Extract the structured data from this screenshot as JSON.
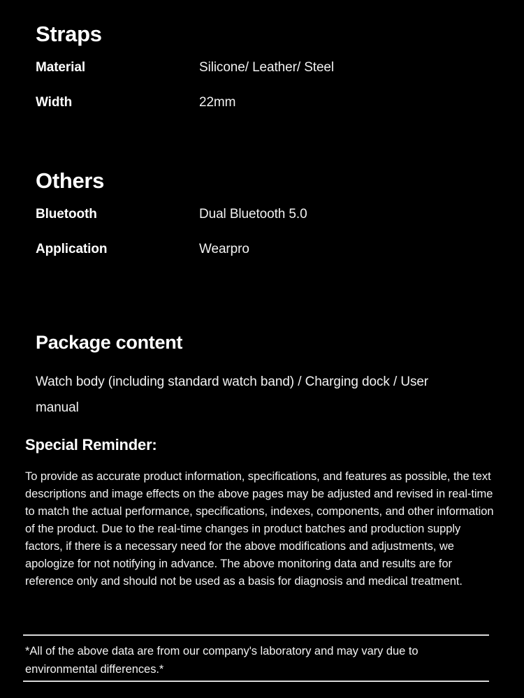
{
  "sections": [
    {
      "heading": "Straps",
      "rows": [
        {
          "label": "Material",
          "value": "Silicone/ Leather/ Steel"
        },
        {
          "label": "Width",
          "value": "22mm"
        }
      ]
    },
    {
      "heading": "Others",
      "rows": [
        {
          "label": "Bluetooth",
          "value": "Dual Bluetooth 5.0"
        },
        {
          "label": "Application",
          "value": "Wearpro"
        }
      ]
    }
  ],
  "package": {
    "heading": "Package content",
    "text": "Watch body (including standard watch band) / Charging dock / User manual"
  },
  "reminder": {
    "heading": "Special Reminder:",
    "text": "To provide as accurate product information, specifications, and features as possible, the text descriptions and image effects on the above pages may be adjusted and revised in real-time to match the actual performance, specifications, indexes, components, and other information of the product. Due to the real-time changes in product batches and production supply factors, if there is a necessary need for the above modifications and adjustments, we apologize for not notifying in advance. The above monitoring data and results are for reference only and should not be used as a basis for diagnosis and medical treatment."
  },
  "footer": {
    "text": "*All of the above data are from our company's laboratory and may vary due to environmental differences.*"
  },
  "colors": {
    "background": "#000000",
    "text": "#ffffff",
    "body_text": "#f2f2f2",
    "rule": "#d9d9d9"
  }
}
